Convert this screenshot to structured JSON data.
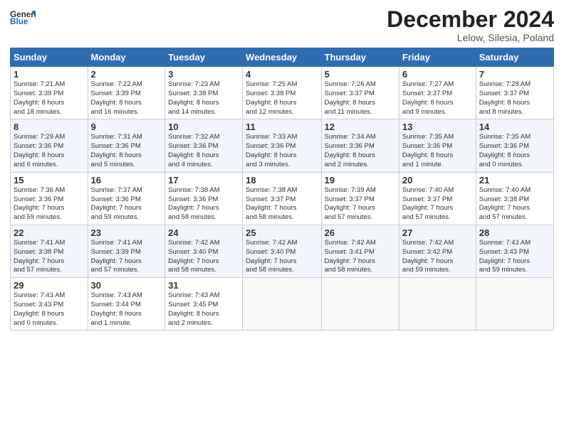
{
  "header": {
    "logo_general": "General",
    "logo_blue": "Blue",
    "month": "December 2024",
    "location": "Lelow, Silesia, Poland"
  },
  "days_of_week": [
    "Sunday",
    "Monday",
    "Tuesday",
    "Wednesday",
    "Thursday",
    "Friday",
    "Saturday"
  ],
  "weeks": [
    [
      {
        "day": "1",
        "text": "Sunrise: 7:21 AM\nSunset: 3:39 PM\nDaylight: 8 hours\nand 18 minutes."
      },
      {
        "day": "2",
        "text": "Sunrise: 7:22 AM\nSunset: 3:39 PM\nDaylight: 8 hours\nand 16 minutes."
      },
      {
        "day": "3",
        "text": "Sunrise: 7:23 AM\nSunset: 3:38 PM\nDaylight: 8 hours\nand 14 minutes."
      },
      {
        "day": "4",
        "text": "Sunrise: 7:25 AM\nSunset: 3:38 PM\nDaylight: 8 hours\nand 12 minutes."
      },
      {
        "day": "5",
        "text": "Sunrise: 7:26 AM\nSunset: 3:37 PM\nDaylight: 8 hours\nand 11 minutes."
      },
      {
        "day": "6",
        "text": "Sunrise: 7:27 AM\nSunset: 3:37 PM\nDaylight: 8 hours\nand 9 minutes."
      },
      {
        "day": "7",
        "text": "Sunrise: 7:28 AM\nSunset: 3:37 PM\nDaylight: 8 hours\nand 8 minutes."
      }
    ],
    [
      {
        "day": "8",
        "text": "Sunrise: 7:29 AM\nSunset: 3:36 PM\nDaylight: 8 hours\nand 6 minutes."
      },
      {
        "day": "9",
        "text": "Sunrise: 7:31 AM\nSunset: 3:36 PM\nDaylight: 8 hours\nand 5 minutes."
      },
      {
        "day": "10",
        "text": "Sunrise: 7:32 AM\nSunset: 3:36 PM\nDaylight: 8 hours\nand 4 minutes."
      },
      {
        "day": "11",
        "text": "Sunrise: 7:33 AM\nSunset: 3:36 PM\nDaylight: 8 hours\nand 3 minutes."
      },
      {
        "day": "12",
        "text": "Sunrise: 7:34 AM\nSunset: 3:36 PM\nDaylight: 8 hours\nand 2 minutes."
      },
      {
        "day": "13",
        "text": "Sunrise: 7:35 AM\nSunset: 3:36 PM\nDaylight: 8 hours\nand 1 minute."
      },
      {
        "day": "14",
        "text": "Sunrise: 7:35 AM\nSunset: 3:36 PM\nDaylight: 8 hours\nand 0 minutes."
      }
    ],
    [
      {
        "day": "15",
        "text": "Sunrise: 7:36 AM\nSunset: 3:36 PM\nDaylight: 7 hours\nand 59 minutes."
      },
      {
        "day": "16",
        "text": "Sunrise: 7:37 AM\nSunset: 3:36 PM\nDaylight: 7 hours\nand 59 minutes."
      },
      {
        "day": "17",
        "text": "Sunrise: 7:38 AM\nSunset: 3:36 PM\nDaylight: 7 hours\nand 58 minutes."
      },
      {
        "day": "18",
        "text": "Sunrise: 7:38 AM\nSunset: 3:37 PM\nDaylight: 7 hours\nand 58 minutes."
      },
      {
        "day": "19",
        "text": "Sunrise: 7:39 AM\nSunset: 3:37 PM\nDaylight: 7 hours\nand 57 minutes."
      },
      {
        "day": "20",
        "text": "Sunrise: 7:40 AM\nSunset: 3:37 PM\nDaylight: 7 hours\nand 57 minutes."
      },
      {
        "day": "21",
        "text": "Sunrise: 7:40 AM\nSunset: 3:38 PM\nDaylight: 7 hours\nand 57 minutes."
      }
    ],
    [
      {
        "day": "22",
        "text": "Sunrise: 7:41 AM\nSunset: 3:38 PM\nDaylight: 7 hours\nand 57 minutes."
      },
      {
        "day": "23",
        "text": "Sunrise: 7:41 AM\nSunset: 3:39 PM\nDaylight: 7 hours\nand 57 minutes."
      },
      {
        "day": "24",
        "text": "Sunrise: 7:42 AM\nSunset: 3:40 PM\nDaylight: 7 hours\nand 58 minutes."
      },
      {
        "day": "25",
        "text": "Sunrise: 7:42 AM\nSunset: 3:40 PM\nDaylight: 7 hours\nand 58 minutes."
      },
      {
        "day": "26",
        "text": "Sunrise: 7:42 AM\nSunset: 3:41 PM\nDaylight: 7 hours\nand 58 minutes."
      },
      {
        "day": "27",
        "text": "Sunrise: 7:42 AM\nSunset: 3:42 PM\nDaylight: 7 hours\nand 59 minutes."
      },
      {
        "day": "28",
        "text": "Sunrise: 7:43 AM\nSunset: 3:43 PM\nDaylight: 7 hours\nand 59 minutes."
      }
    ],
    [
      {
        "day": "29",
        "text": "Sunrise: 7:43 AM\nSunset: 3:43 PM\nDaylight: 8 hours\nand 0 minutes."
      },
      {
        "day": "30",
        "text": "Sunrise: 7:43 AM\nSunset: 3:44 PM\nDaylight: 8 hours\nand 1 minute."
      },
      {
        "day": "31",
        "text": "Sunrise: 7:43 AM\nSunset: 3:45 PM\nDaylight: 8 hours\nand 2 minutes."
      },
      null,
      null,
      null,
      null
    ]
  ]
}
